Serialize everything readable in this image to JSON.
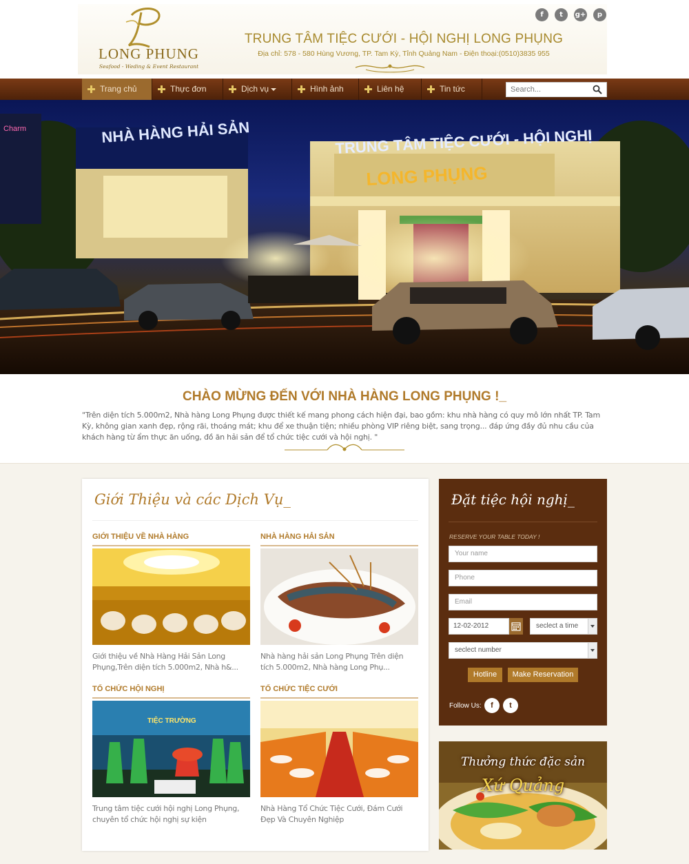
{
  "header": {
    "logo_letter": "P",
    "logo_name": "LONG PHUNG",
    "logo_tagline": "Seafood - Weding & Event Restaurant",
    "title": "TRUNG TÂM TIỆC CƯỚI - HỘI NGHỊ  LONG PHỤNG",
    "address": "Địa chỉ: 578 - 580 Hùng Vương, TP. Tam Kỳ, Tỉnh Quảng Nam - Điện thoại:(0510)3835 955",
    "social": [
      {
        "icon": "facebook-icon",
        "glyph": "f"
      },
      {
        "icon": "twitter-icon",
        "glyph": "t"
      },
      {
        "icon": "google-plus-icon",
        "glyph": "g+"
      },
      {
        "icon": "pinterest-icon",
        "glyph": "p"
      }
    ]
  },
  "nav": {
    "items": [
      {
        "label": "Trang chủ",
        "active": true
      },
      {
        "label": "Thực đơn"
      },
      {
        "label": "Dịch vụ",
        "dropdown": true
      },
      {
        "label": "Hình ảnh"
      },
      {
        "label": "Liên hệ"
      },
      {
        "label": "Tin tức"
      }
    ],
    "search_placeholder": "Search..."
  },
  "hero": {
    "sign_left": "NHÀ HÀNG HẢI SẢN",
    "sign_right": "TRUNG TÂM TIỆC CƯỚI - HỘI NGHỊ",
    "sign_main": "LONG PHỤNG",
    "sign_small": "Charm"
  },
  "welcome": {
    "title": "CHÀO MỪNG ĐẾN VỚI NHÀ HÀNG LONG PHỤNG !_",
    "text": "\"Trên diện tích 5.000m2, Nhà hàng Long Phụng được thiết kế mang phong cách hiện đại, bao gồm: khu nhà hàng có quy mô lớn nhất TP. Tam Kỳ, không gian xanh đẹp, rộng rãi, thoáng mát; khu để xe thuận tiện; nhiều phòng VIP riêng biệt, sang trọng... đáp ứng đầy đủ nhu cầu của khách hàng từ ẩm thực ăn uống, đồ ăn hải sản để tổ chức tiệc cưới và hội nghị. \""
  },
  "services": {
    "title": "Giới Thiệu và các Dịch Vụ_",
    "cards": [
      {
        "title": "GIỚI THIỆU VỀ NHÀ HÀNG",
        "desc": "Giới thiệu về Nhà Hàng Hải Sản Long Phụng,Trên diện tích 5.000m2, Nhà h&..."
      },
      {
        "title": "NHÀ HÀNG HẢI SẢN",
        "desc": "Nhà hàng hải sản Long Phụng Trên diện tích 5.000m2, Nhà hàng Long Phụ..."
      },
      {
        "title": "TỔ CHỨC HỘI NGHỊ",
        "desc": "Trung tâm tiệc cưới hội nghị Long Phụng, chuyên tổ chức hội nghị sự kiện",
        "photo_text": "TIỆC      TRƯỜNG"
      },
      {
        "title": "TỔ CHỨC TIỆC CƯỚI",
        "desc": "Nhà Hàng Tổ Chức Tiệc Cưới, Đám Cưới Đẹp Và Chuyên Nghiệp"
      }
    ]
  },
  "reservation": {
    "title": "Đặt tiệc hội nghị_",
    "subtitle": "RESERVE YOUR TABLE TODAY !",
    "name_placeholder": "Your name",
    "phone_placeholder": "Phone",
    "email_placeholder": "Email",
    "date_value": "12-02-2012",
    "time_select": "seclect a time",
    "number_select": "seclect number",
    "hotline_label": "Hotline",
    "submit_label": "Make Reservation",
    "follow_label": "Follow Us:"
  },
  "banner": {
    "line1": "Thưởng thức đặc sản",
    "line2": "Xứ Quảng"
  },
  "colors": {
    "brand_brown": "#5b2d0f",
    "accent_gold": "#b07a2a",
    "nav_active": "#9b6a2e"
  }
}
